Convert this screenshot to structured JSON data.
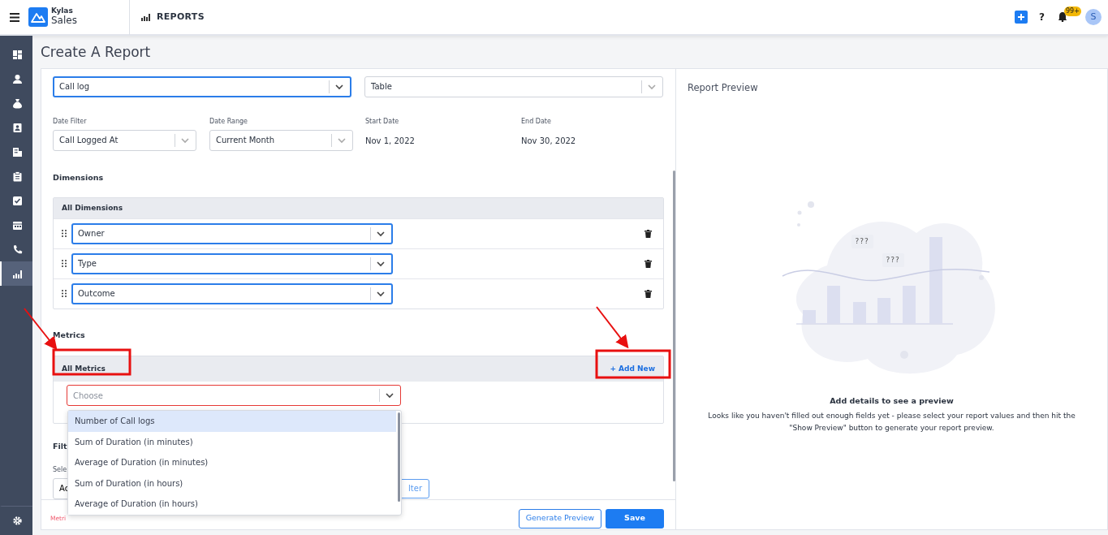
{
  "topbar": {
    "brand_top": "Kylas",
    "brand_bottom": "Sales",
    "module": "REPORTS",
    "help": "?",
    "notification_badge": "99+",
    "avatar": "S"
  },
  "sidebar": {
    "items": [
      {
        "selected": false
      },
      {
        "selected": false
      },
      {
        "selected": false
      },
      {
        "selected": false
      },
      {
        "selected": false
      },
      {
        "selected": false
      },
      {
        "selected": false
      },
      {
        "selected": false
      },
      {
        "selected": false
      },
      {
        "selected": true
      }
    ]
  },
  "page_title": "Create A Report",
  "form": {
    "entity": {
      "value": "Call log",
      "focused": true
    },
    "report_type": {
      "value": "Table",
      "focused": false
    },
    "date_fields": [
      {
        "kind": "select",
        "label": "Date Filter",
        "value": "Call Logged At"
      },
      {
        "kind": "select",
        "label": "Date Range",
        "value": "Current Month"
      },
      {
        "kind": "text",
        "label": "Start Date",
        "value": "Nov 1, 2022"
      },
      {
        "kind": "text",
        "label": "End Date",
        "value": "Nov 30, 2022"
      }
    ]
  },
  "dimensions": {
    "heading": "Dimensions",
    "header": "All Dimensions",
    "rows": [
      {
        "value": "Owner",
        "focused": true
      },
      {
        "value": "Type",
        "focused": true
      },
      {
        "value": "Outcome",
        "focused": true
      }
    ]
  },
  "metrics": {
    "heading": "Metrics",
    "header": "All Metrics",
    "add_new": "+ Add New",
    "placeholder": "Choose",
    "error": true,
    "options": [
      {
        "label": "Number of Call logs",
        "selected": true
      },
      {
        "label": "Sum of Duration (in minutes)",
        "selected": false
      },
      {
        "label": "Average of Duration (in minutes)",
        "selected": false
      },
      {
        "label": "Sum of Duration (in hours)",
        "selected": false
      },
      {
        "label": "Average of Duration (in hours)",
        "selected": false
      }
    ]
  },
  "filters": {
    "heading": "Filt",
    "label": "Sele",
    "input_value": "Ac",
    "button": "lter"
  },
  "footer": {
    "error_text": "Metri",
    "buttons": [
      {
        "label": "Generate Preview",
        "kind": "outline"
      },
      {
        "label": "Save",
        "kind": "primary"
      }
    ]
  },
  "preview": {
    "title": "Report Preview",
    "bubbles": [
      "???",
      "???"
    ],
    "empty_title": "Add details to see a preview",
    "empty_text": "Looks like you haven't filled out enough fields yet - please select your report values and then hit the \"Show Preview\" button to generate your report preview."
  }
}
